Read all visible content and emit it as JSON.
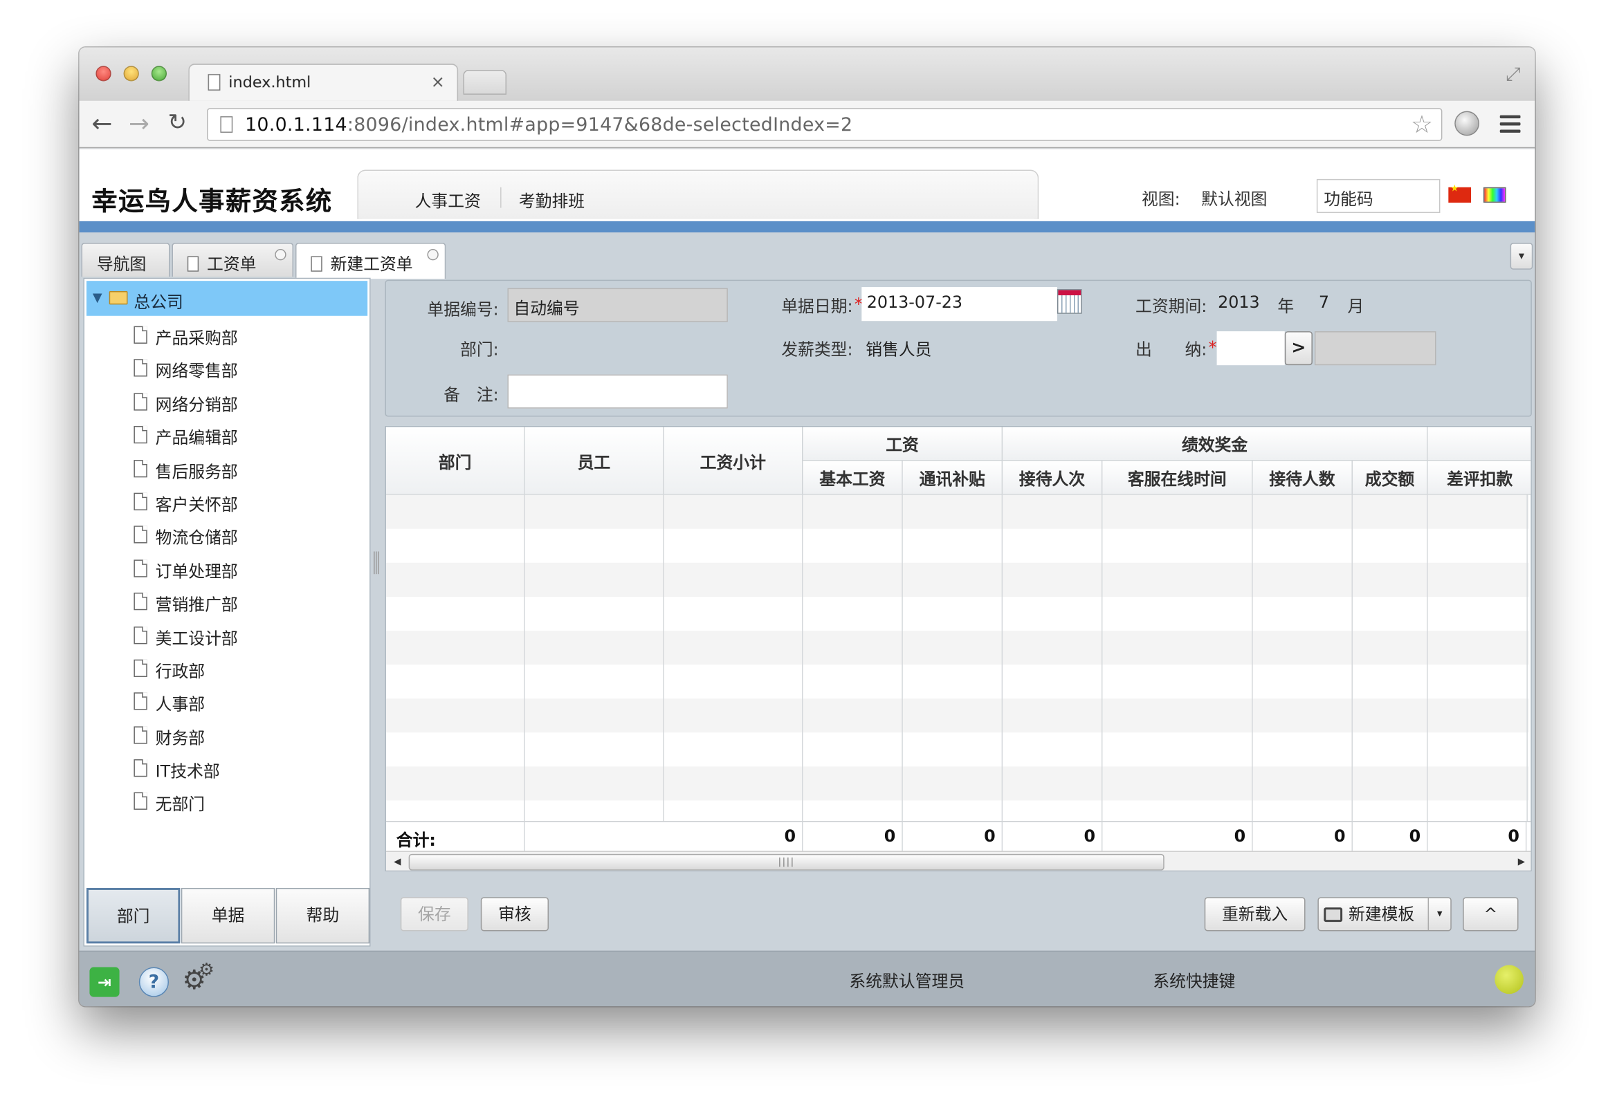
{
  "browser": {
    "tab_title": "index.html",
    "tab_close": "×",
    "url_host": "10.0.1.114",
    "url_rest": ":8096/index.html#app=9147&68de-selectedIndex=2"
  },
  "header": {
    "app_title": "幸运鸟人事薪资系统",
    "module_tabs": [
      "人事工资",
      "考勤排班"
    ],
    "view_label": "视图:",
    "view_value": "默认视图",
    "func_placeholder": "功能码"
  },
  "page_tabs": [
    "导航图",
    "工资单",
    "新建工资单"
  ],
  "sidebar": {
    "root": "总公司",
    "items": [
      "产品采购部",
      "网络零售部",
      "网络分销部",
      "产品编辑部",
      "售后服务部",
      "客户关怀部",
      "物流仓储部",
      "订单处理部",
      "营销推广部",
      "美工设计部",
      "行政部",
      "人事部",
      "财务部",
      "IT技术部",
      "无部门"
    ],
    "buttons": [
      "部门",
      "单据",
      "帮助"
    ]
  },
  "form": {
    "doc_no_label": "单据编号:",
    "doc_no_value": "自动编号",
    "date_label": "单据日期:",
    "date_value": "2013-07-23",
    "period_label": "工资期间:",
    "period_year": "2013",
    "year_unit": "年",
    "period_month": "7",
    "month_unit": "月",
    "dept_label": "部门:",
    "pay_type_label": "发薪类型:",
    "pay_type_value": "销售人员",
    "cashier_label_1": "出",
    "cashier_label_2": "纳:",
    "pick_label": ">",
    "remark_label_1": "备",
    "remark_label_2": "注:",
    "required_mark": "*"
  },
  "grid": {
    "columns": [
      "部门",
      "员工",
      "工资小计"
    ],
    "groups": [
      "工资",
      "绩效奖金"
    ],
    "sub_columns": [
      "基本工资",
      "通讯补贴",
      "接待人次",
      "客服在线时间",
      "接待人数",
      "成交额",
      "差评扣款"
    ],
    "footer_label": "合计:",
    "footer_values": [
      "0",
      "0",
      "0",
      "0",
      "0",
      "0",
      "0",
      "0"
    ],
    "scroll_grip": "||||"
  },
  "actions": {
    "save": "保存",
    "audit": "审核",
    "reload": "重新载入",
    "new_template": "新建模板",
    "caret": "▾",
    "up": "^"
  },
  "status": {
    "user": "系统默认管理员",
    "shortcuts": "系统快捷键"
  }
}
